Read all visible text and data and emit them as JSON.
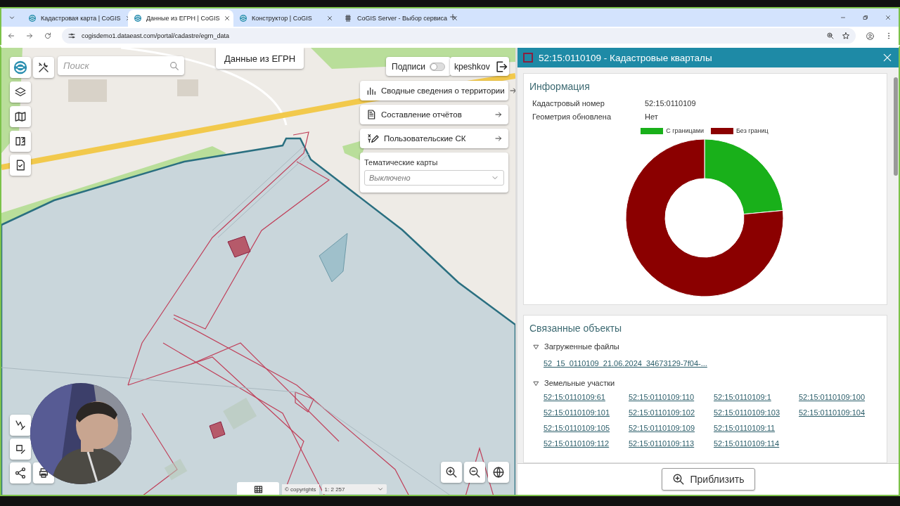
{
  "browser": {
    "tabs": [
      {
        "title": "Кадастровая карта | CoGIS",
        "selected": false
      },
      {
        "title": "Данные из ЕГРН | CoGIS",
        "selected": true
      },
      {
        "title": "Конструктор | CoGIS",
        "selected": false
      },
      {
        "title": "CoGIS Server - Выбор сервиса",
        "selected": false
      }
    ],
    "url": "cogisdemo1.dataeast.com/portal/cadastre/egrn_data"
  },
  "map": {
    "title": "Данные из ЕГРН",
    "search": {
      "placeholder": "Поиск"
    },
    "labels_toggle": {
      "label": "Подписи",
      "on": false
    },
    "user": "kpeshkov",
    "actions": [
      {
        "label": "Сводные сведения о территории"
      },
      {
        "label": "Составление отчётов"
      },
      {
        "label": "Пользовательские СК"
      }
    ],
    "thematic": {
      "label": "Тематические карты",
      "value": "Выключено"
    },
    "copyrights": "© copyrights",
    "scale": "1: 2 257"
  },
  "panel": {
    "title": "52:15:0110109 - Кадастровые кварталы",
    "info": {
      "heading": "Информация",
      "fields": [
        {
          "label": "Кадастровый номер",
          "value": "52:15:0110109"
        },
        {
          "label": "Геометрия обновлена",
          "value": "Нет"
        }
      ],
      "legend": [
        {
          "label": "С границами",
          "color": "#19b01a"
        },
        {
          "label": "Без границ",
          "color": "#8b0000"
        }
      ]
    },
    "related": {
      "heading": "Связанные объекты",
      "groups": [
        {
          "title": "Загруженные файлы",
          "expanded": true,
          "rows": [
            [
              "52_15_0110109_21.06.2024_34673129-7f04-..."
            ]
          ]
        },
        {
          "title": "Земельные участки",
          "expanded": true,
          "rows": [
            [
              "52:15:0110109:61",
              "52:15:0110109:110",
              "52:15:0110109:1",
              "52:15:0110109:100"
            ],
            [
              "52:15:0110109:101",
              "52:15:0110109:102",
              "52:15:0110109:103",
              "52:15:0110109:104"
            ],
            [
              "52:15:0110109:105",
              "52:15:0110109:109",
              "52:15:0110109:11"
            ],
            [
              "52:15:0110109:112",
              "52:15:0110109:113",
              "52:15:0110109:114"
            ]
          ]
        }
      ]
    },
    "zoom_button": "Приблизить"
  }
}
